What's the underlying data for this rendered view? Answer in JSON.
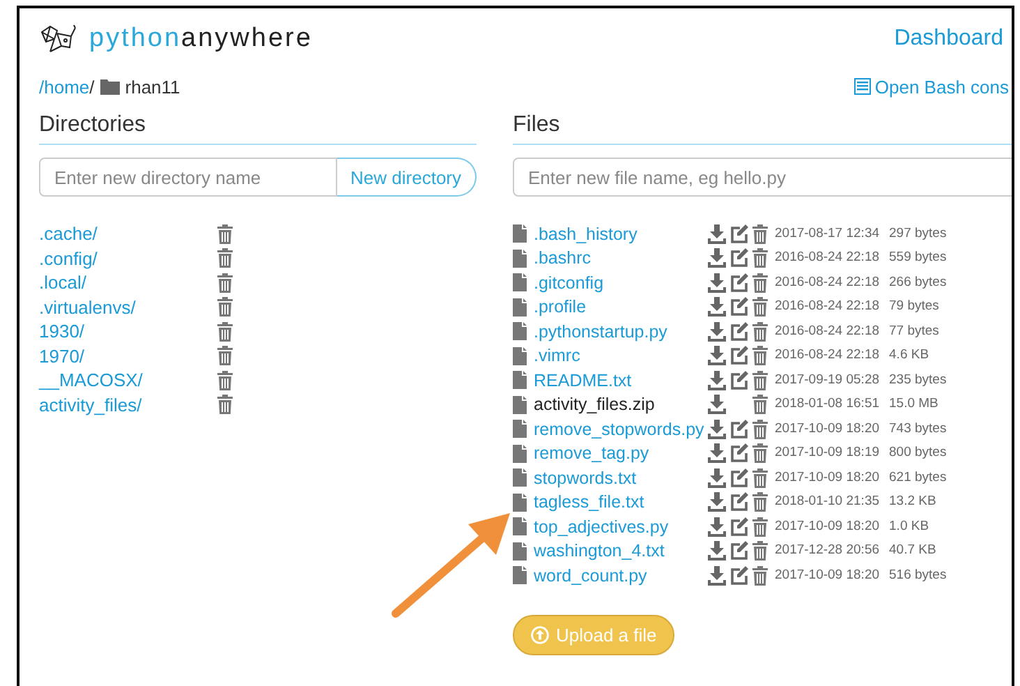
{
  "header": {
    "brand_first": "python",
    "brand_second": "anywhere",
    "nav_link": "Dashboard"
  },
  "breadcrumb": {
    "root": "/home",
    "separator": "/",
    "current": "rhan11"
  },
  "console_link": "Open Bash cons",
  "directories": {
    "title": "Directories",
    "placeholder": "Enter new directory name",
    "button": "New directory",
    "items": [
      {
        "name": ".cache/"
      },
      {
        "name": ".config/"
      },
      {
        "name": ".local/"
      },
      {
        "name": ".virtualenvs/"
      },
      {
        "name": "1930/"
      },
      {
        "name": "1970/"
      },
      {
        "name": "__MACOSX/"
      },
      {
        "name": "activity_files/"
      }
    ]
  },
  "files": {
    "title": "Files",
    "placeholder": "Enter new file name, eg hello.py",
    "items": [
      {
        "name": ".bash_history",
        "editable": true,
        "modified": "2017-08-17 12:34",
        "size": "297 bytes"
      },
      {
        "name": ".bashrc",
        "editable": true,
        "modified": "2016-08-24 22:18",
        "size": "559 bytes"
      },
      {
        "name": ".gitconfig",
        "editable": true,
        "modified": "2016-08-24 22:18",
        "size": "266 bytes"
      },
      {
        "name": ".profile",
        "editable": true,
        "modified": "2016-08-24 22:18",
        "size": "79 bytes"
      },
      {
        "name": ".pythonstartup.py",
        "editable": true,
        "modified": "2016-08-24 22:18",
        "size": "77 bytes"
      },
      {
        "name": ".vimrc",
        "editable": true,
        "modified": "2016-08-24 22:18",
        "size": "4.6 KB"
      },
      {
        "name": "README.txt",
        "editable": true,
        "modified": "2017-09-19 05:28",
        "size": "235 bytes"
      },
      {
        "name": "activity_files.zip",
        "editable": false,
        "modified": "2018-01-08 16:51",
        "size": "15.0 MB"
      },
      {
        "name": "remove_stopwords.py",
        "editable": true,
        "modified": "2017-10-09 18:20",
        "size": "743 bytes"
      },
      {
        "name": "remove_tag.py",
        "editable": true,
        "modified": "2017-10-09 18:19",
        "size": "800 bytes"
      },
      {
        "name": "stopwords.txt",
        "editable": true,
        "modified": "2017-10-09 18:20",
        "size": "621 bytes"
      },
      {
        "name": "tagless_file.txt",
        "editable": true,
        "modified": "2018-01-10 21:35",
        "size": "13.2 KB"
      },
      {
        "name": "top_adjectives.py",
        "editable": true,
        "modified": "2017-10-09 18:20",
        "size": "1.0 KB"
      },
      {
        "name": "washington_4.txt",
        "editable": true,
        "modified": "2017-12-28 20:56",
        "size": "40.7 KB"
      },
      {
        "name": "word_count.py",
        "editable": true,
        "modified": "2017-10-09 18:20",
        "size": "516 bytes"
      }
    ],
    "upload_button": "Upload a file"
  }
}
